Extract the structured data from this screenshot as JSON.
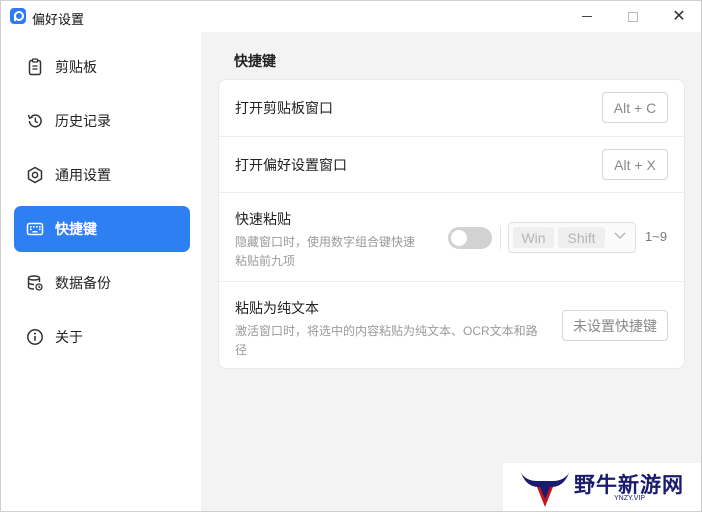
{
  "window": {
    "title": "偏好设置"
  },
  "sidebar": {
    "items": [
      {
        "label": "剪贴板",
        "icon": "clipboard-icon",
        "active": false
      },
      {
        "label": "历史记录",
        "icon": "history-icon",
        "active": false
      },
      {
        "label": "通用设置",
        "icon": "hexagon-settings-icon",
        "active": false
      },
      {
        "label": "快捷键",
        "icon": "keyboard-icon",
        "active": true
      },
      {
        "label": "数据备份",
        "icon": "database-icon",
        "active": false
      },
      {
        "label": "关于",
        "icon": "info-icon",
        "active": false
      }
    ]
  },
  "main": {
    "section_title": "快捷键",
    "rows": {
      "open_clipboard": {
        "label": "打开剪贴板窗口",
        "shortcut": "Alt + C"
      },
      "open_preferences": {
        "label": "打开偏好设置窗口",
        "shortcut": "Alt + X"
      },
      "quick_paste": {
        "label": "快速粘贴",
        "description_line1": "隐藏窗口时，使用数字组合键快速",
        "description_line2": "粘贴前九项",
        "toggle_on": false,
        "modifier_1": "Win",
        "modifier_2": "Shift",
        "range": "1~9"
      },
      "paste_plain": {
        "label": "粘贴为纯文本",
        "description_line1": "激活窗口时，将选中的内容粘贴为纯文本、OCR文本和路",
        "description_line2": "径",
        "shortcut": "未设置快捷键"
      }
    }
  },
  "watermark": {
    "text": "野牛新游网",
    "sub": "YNZY.VIP"
  },
  "colors": {
    "accent": "#2e80f2",
    "sidebar_bg": "#ffffff",
    "main_bg": "#f3f3f3"
  }
}
